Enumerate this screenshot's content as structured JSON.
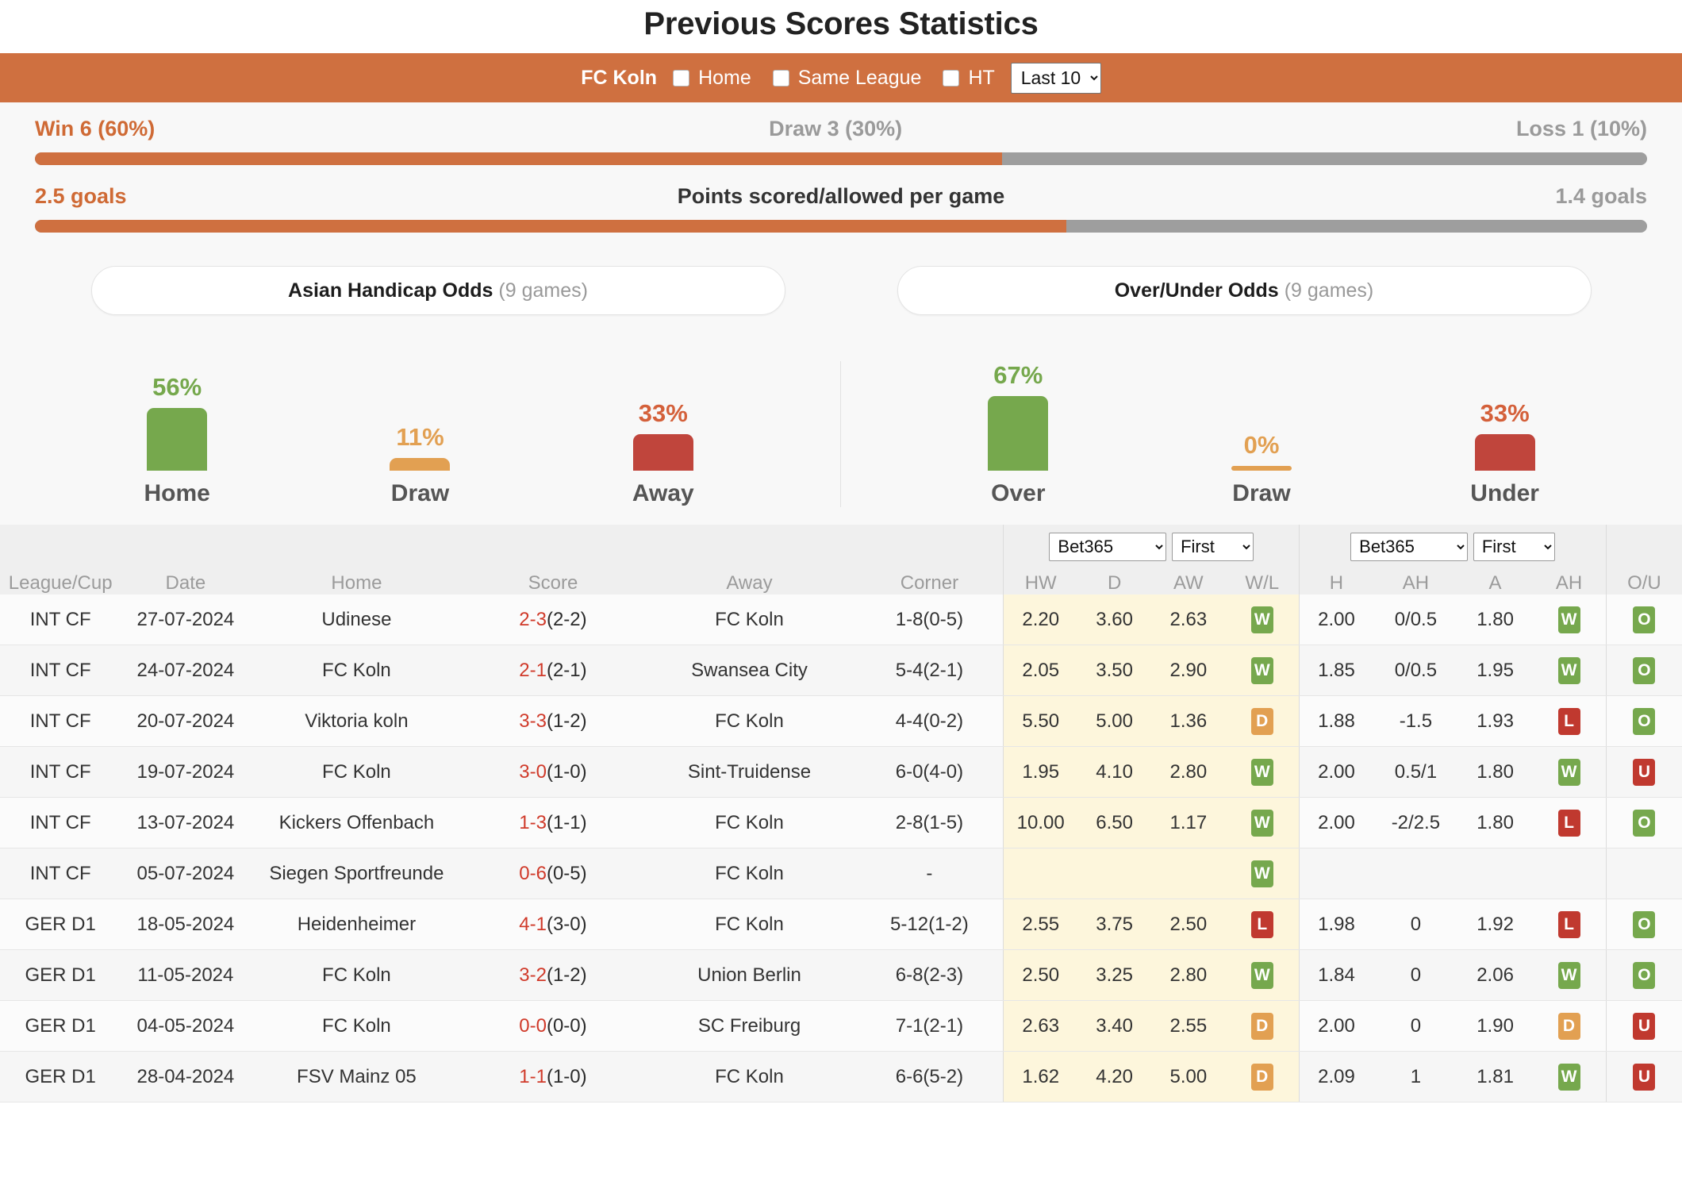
{
  "title": "Previous Scores Statistics",
  "control_bar": {
    "team": "FC Koln",
    "checkbox_home": "Home",
    "checkbox_same_league": "Same League",
    "checkbox_ht": "HT",
    "range_select": "Last 10"
  },
  "stats": {
    "wdl": {
      "left": "Win 6 (60%)",
      "mid": "Draw 3 (30%)",
      "right": "Loss 1 (10%)",
      "fill_percent": 60
    },
    "goals": {
      "left": "2.5 goals",
      "mid": "Points scored/allowed per game",
      "right": "1.4 goals",
      "fill_percent": 64
    }
  },
  "odds_buttons": [
    {
      "label": "Asian Handicap Odds",
      "games": "(9 games)"
    },
    {
      "label": "Over/Under Odds",
      "games": "(9 games)"
    }
  ],
  "chart_data": [
    {
      "type": "bar",
      "title": "Asian Handicap Odds",
      "categories": [
        "Home",
        "Draw",
        "Away"
      ],
      "values": [
        56,
        11,
        33
      ],
      "value_labels": [
        "56%",
        "11%",
        "33%"
      ],
      "colors": [
        "#76a84d",
        "#e2a052",
        "#c0453c"
      ],
      "ylabel": "",
      "xlabel": "",
      "ylim": [
        0,
        100
      ]
    },
    {
      "type": "bar",
      "title": "Over/Under Odds",
      "categories": [
        "Over",
        "Draw",
        "Under"
      ],
      "values": [
        67,
        0,
        33
      ],
      "value_labels": [
        "67%",
        "0%",
        "33%"
      ],
      "colors": [
        "#76a84d",
        "#e2a052",
        "#c0453c"
      ],
      "ylabel": "",
      "xlabel": "",
      "ylim": [
        0,
        100
      ]
    }
  ],
  "table": {
    "headers": {
      "league": "League/Cup",
      "date": "Date",
      "home": "Home",
      "score": "Score",
      "away": "Away",
      "corner": "Corner",
      "ou": "O/U"
    },
    "group1": {
      "bookmaker": "Bet365",
      "period": "First",
      "cols": [
        "HW",
        "D",
        "AW",
        "W/L"
      ]
    },
    "group2": {
      "bookmaker": "Bet365",
      "period": "First",
      "cols": [
        "H",
        "AH",
        "A",
        "AH"
      ]
    },
    "rows": [
      {
        "league": "INT CF",
        "date": "27-07-2024",
        "home": "Udinese",
        "home_koln": false,
        "score_main": "2-3",
        "score_ht": "(2-2)",
        "away": "FC Koln",
        "away_koln": true,
        "corner": "1-8(0-5)",
        "hw": "2.20",
        "d": "3.60",
        "aw": "2.63",
        "wl": "W",
        "h": "2.00",
        "ah1": "0/0.5",
        "a": "1.80",
        "ah2": "W",
        "ou": "O"
      },
      {
        "league": "INT CF",
        "date": "24-07-2024",
        "home": "FC Koln",
        "home_koln": true,
        "score_main": "2-1",
        "score_ht": "(2-1)",
        "away": "Swansea City",
        "away_koln": false,
        "corner": "5-4(2-1)",
        "hw": "2.05",
        "d": "3.50",
        "aw": "2.90",
        "wl": "W",
        "h": "1.85",
        "ah1": "0/0.5",
        "a": "1.95",
        "ah2": "W",
        "ou": "O"
      },
      {
        "league": "INT CF",
        "date": "20-07-2024",
        "home": "Viktoria koln",
        "home_koln": false,
        "score_main": "3-3",
        "score_ht": "(1-2)",
        "away": "FC Koln",
        "away_koln": true,
        "corner": "4-4(0-2)",
        "hw": "5.50",
        "d": "5.00",
        "aw": "1.36",
        "wl": "D",
        "h": "1.88",
        "ah1": "-1.5",
        "a": "1.93",
        "ah2": "L",
        "ou": "O"
      },
      {
        "league": "INT CF",
        "date": "19-07-2024",
        "home": "FC Koln",
        "home_koln": true,
        "score_main": "3-0",
        "score_ht": "(1-0)",
        "away": "Sint-Truidense",
        "away_koln": false,
        "corner": "6-0(4-0)",
        "hw": "1.95",
        "d": "4.10",
        "aw": "2.80",
        "wl": "W",
        "h": "2.00",
        "ah1": "0.5/1",
        "a": "1.80",
        "ah2": "W",
        "ou": "U"
      },
      {
        "league": "INT CF",
        "date": "13-07-2024",
        "home": "Kickers Offenbach",
        "home_koln": false,
        "score_main": "1-3",
        "score_ht": "(1-1)",
        "away": "FC Koln",
        "away_koln": true,
        "corner": "2-8(1-5)",
        "hw": "10.00",
        "d": "6.50",
        "aw": "1.17",
        "wl": "W",
        "h": "2.00",
        "ah1": "-2/2.5",
        "a": "1.80",
        "ah2": "L",
        "ou": "O"
      },
      {
        "league": "INT CF",
        "date": "05-07-2024",
        "home": "Siegen Sportfreunde",
        "home_koln": false,
        "score_main": "0-6",
        "score_ht": "(0-5)",
        "away": "FC Koln",
        "away_koln": true,
        "corner": "-",
        "hw": "",
        "d": "",
        "aw": "",
        "wl": "W",
        "h": "",
        "ah1": "",
        "a": "",
        "ah2": "",
        "ou": ""
      },
      {
        "league": "GER D1",
        "date": "18-05-2024",
        "home": "Heidenheimer",
        "home_koln": false,
        "score_main": "4-1",
        "score_ht": "(3-0)",
        "away": "FC Koln",
        "away_koln": true,
        "corner": "5-12(1-2)",
        "hw": "2.55",
        "d": "3.75",
        "aw": "2.50",
        "wl": "L",
        "h": "1.98",
        "ah1": "0",
        "a": "1.92",
        "ah2": "L",
        "ou": "O"
      },
      {
        "league": "GER D1",
        "date": "11-05-2024",
        "home": "FC Koln",
        "home_koln": true,
        "score_main": "3-2",
        "score_ht": "(1-2)",
        "away": "Union Berlin",
        "away_koln": false,
        "corner": "6-8(2-3)",
        "hw": "2.50",
        "d": "3.25",
        "aw": "2.80",
        "wl": "W",
        "h": "1.84",
        "ah1": "0",
        "a": "2.06",
        "ah2": "W",
        "ou": "O"
      },
      {
        "league": "GER D1",
        "date": "04-05-2024",
        "home": "FC Koln",
        "home_koln": true,
        "score_main": "0-0",
        "score_ht": "(0-0)",
        "away": "SC Freiburg",
        "away_koln": false,
        "corner": "7-1(2-1)",
        "hw": "2.63",
        "d": "3.40",
        "aw": "2.55",
        "wl": "D",
        "h": "2.00",
        "ah1": "0",
        "a": "1.90",
        "ah2": "D",
        "ou": "U"
      },
      {
        "league": "GER D1",
        "date": "28-04-2024",
        "home": "FSV Mainz 05",
        "home_koln": false,
        "score_main": "1-1",
        "score_ht": "(1-0)",
        "away": "FC Koln",
        "away_koln": true,
        "corner": "6-6(5-2)",
        "hw": "1.62",
        "d": "4.20",
        "aw": "5.00",
        "wl": "D",
        "h": "2.09",
        "ah1": "1",
        "a": "1.81",
        "ah2": "W",
        "ou": "U"
      }
    ]
  }
}
